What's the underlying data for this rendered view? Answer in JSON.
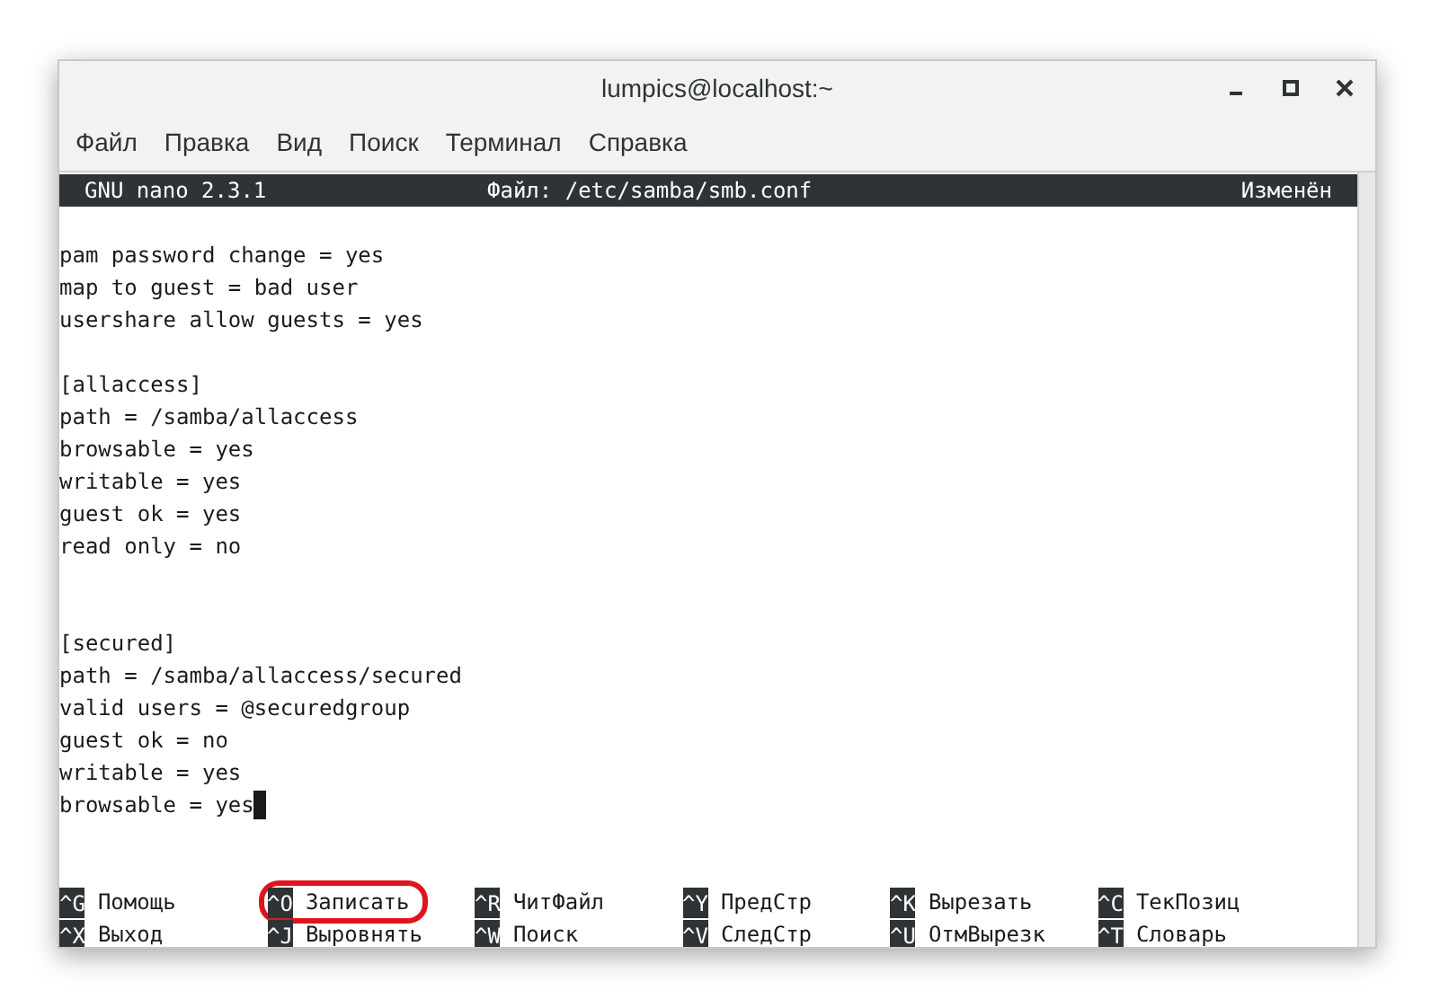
{
  "window": {
    "title": "lumpics@localhost:~"
  },
  "menu": [
    "Файл",
    "Правка",
    "Вид",
    "Поиск",
    "Терминал",
    "Справка"
  ],
  "nano_header": {
    "version": "GNU nano 2.3.1",
    "file": "Файл: /etc/samba/smb.conf",
    "status": "Изменён"
  },
  "lines": [
    {
      "kind": "blank"
    },
    {
      "kind": "text",
      "text": "pam password change = yes",
      "cursor": false
    },
    {
      "kind": "text",
      "text": "map to guest = bad user",
      "cursor": false
    },
    {
      "kind": "text",
      "text": "usershare allow guests = yes",
      "cursor": false
    },
    {
      "kind": "blank"
    },
    {
      "kind": "text",
      "text": "[allaccess]",
      "cursor": false
    },
    {
      "kind": "text",
      "text": "path = /samba/allaccess",
      "cursor": false
    },
    {
      "kind": "text",
      "text": "browsable = yes",
      "cursor": false
    },
    {
      "kind": "text",
      "text": "writable = yes",
      "cursor": false
    },
    {
      "kind": "text",
      "text": "guest ok = yes",
      "cursor": false
    },
    {
      "kind": "text",
      "text": "read only = no",
      "cursor": false
    },
    {
      "kind": "blank"
    },
    {
      "kind": "blank"
    },
    {
      "kind": "text",
      "text": "[secured]",
      "cursor": false
    },
    {
      "kind": "text",
      "text": "path = /samba/allaccess/secured",
      "cursor": false
    },
    {
      "kind": "text",
      "text": "valid users = @securedgroup",
      "cursor": false
    },
    {
      "kind": "text",
      "text": "guest ok = no",
      "cursor": false
    },
    {
      "kind": "text",
      "text": "writable = yes",
      "cursor": false
    },
    {
      "kind": "text",
      "text": "browsable = yes",
      "cursor": true
    }
  ],
  "shortcuts": [
    {
      "key": "^G",
      "label": "Помощь",
      "highlighted": false
    },
    {
      "key": "^O",
      "label": "Записать",
      "highlighted": true
    },
    {
      "key": "^R",
      "label": "ЧитФайл",
      "highlighted": false
    },
    {
      "key": "^Y",
      "label": "ПредСтр",
      "highlighted": false
    },
    {
      "key": "^K",
      "label": "Вырезать",
      "highlighted": false
    },
    {
      "key": "^C",
      "label": "ТекПозиц",
      "highlighted": false
    },
    {
      "key": "^X",
      "label": "Выход",
      "highlighted": false
    },
    {
      "key": "^J",
      "label": "Выровнять",
      "highlighted": false
    },
    {
      "key": "^W",
      "label": "Поиск",
      "highlighted": false
    },
    {
      "key": "^V",
      "label": "СледСтр",
      "highlighted": false
    },
    {
      "key": "^U",
      "label": "ОтмВырезк",
      "highlighted": false
    },
    {
      "key": "^T",
      "label": "Словарь",
      "highlighted": false
    }
  ]
}
